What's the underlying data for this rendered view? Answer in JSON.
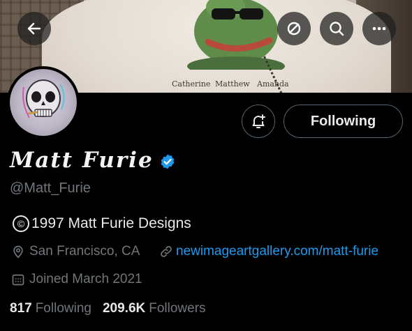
{
  "banner": {
    "names": [
      "Catherine",
      "Matthew",
      "Amanda"
    ]
  },
  "top_bar": {
    "back_icon": "arrow-left-icon",
    "mute_icon": "slashed-circle-icon",
    "search_icon": "search-icon",
    "more_icon": "more-icon"
  },
  "actions": {
    "notify_icon": "bell-plus-icon",
    "following_label": "Following"
  },
  "profile": {
    "display_name": "Matt Furie",
    "verified": true,
    "handle": "@Matt_Furie",
    "bio_symbol": "©",
    "bio": "1997 Matt Furie Designs",
    "location": "San Francisco, CA",
    "website": "newimageartgallery.com/matt-furie",
    "joined": "Joined March 2021"
  },
  "stats": {
    "following_count": "817",
    "following_label": "Following",
    "followers_count": "209.6K",
    "followers_label": "Followers"
  },
  "colors": {
    "accent": "#1d9bf0",
    "muted": "#71767b",
    "text": "#e7e9ea",
    "border": "#536471",
    "background": "#000000"
  }
}
